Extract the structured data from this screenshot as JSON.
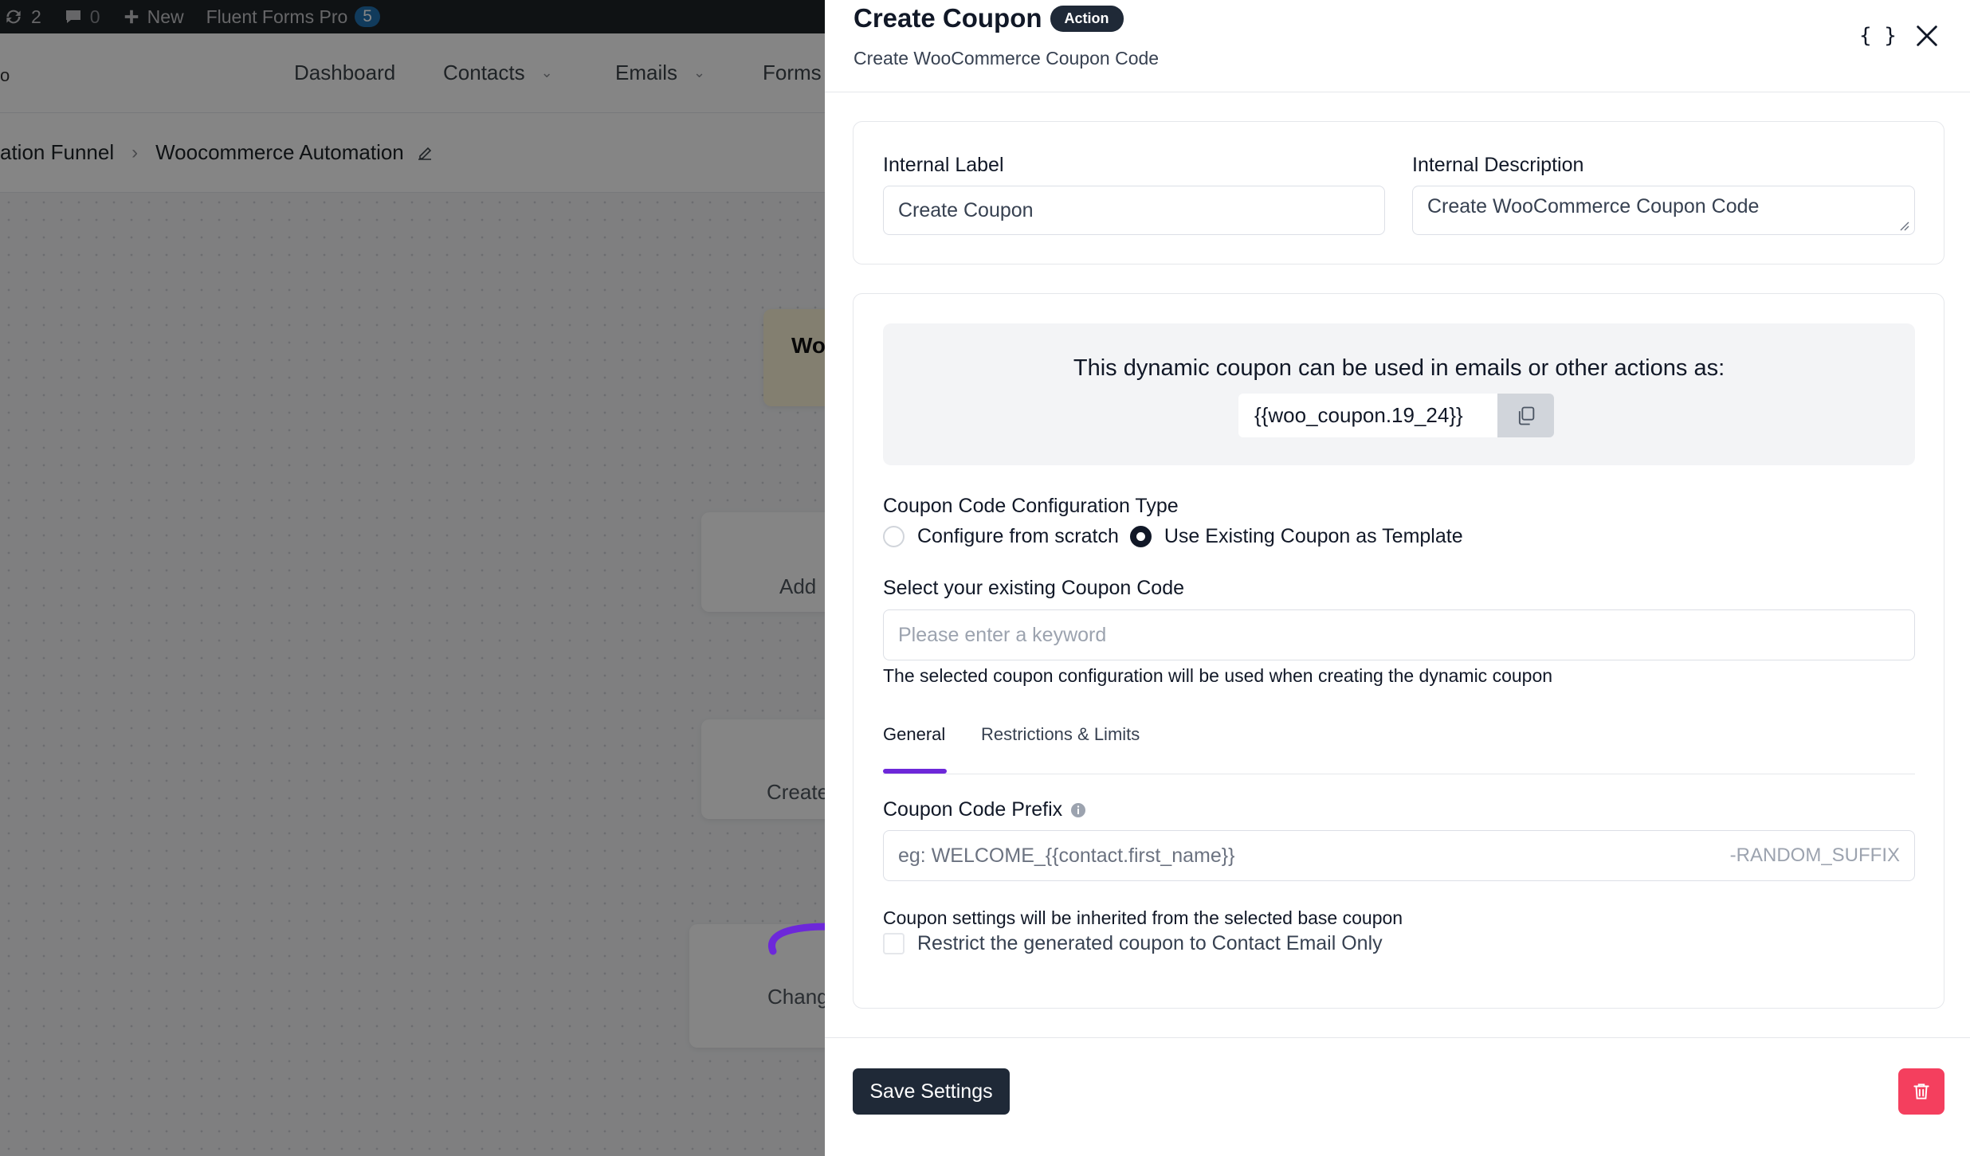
{
  "adminbar": {
    "updates_count": "2",
    "comments_count": "0",
    "new_label": "New",
    "plugin_label": "Fluent Forms Pro",
    "plugin_badge": "5"
  },
  "topnav": {
    "logo_fragment": "o",
    "items": [
      "Dashboard",
      "Contacts",
      "Emails",
      "Forms"
    ]
  },
  "breadcrumb": {
    "parent": "ation Funnel",
    "current": "Woocommerce Automation"
  },
  "canvas": {
    "trigger_node": "Wo",
    "node_add": "Add",
    "node_create": "Create",
    "node_change": "Chang"
  },
  "drawer": {
    "title": "Create Coupon",
    "badge": "Action",
    "subtitle": "Create WooCommerce Coupon Code",
    "braces_label": "{ }"
  },
  "form": {
    "internal_label": {
      "label": "Internal Label",
      "value": "Create Coupon"
    },
    "internal_description": {
      "label": "Internal Description",
      "value": "Create WooCommerce Coupon Code"
    }
  },
  "coupon": {
    "info_text": "This dynamic coupon can be used in emails or other actions as:",
    "smartcode": "{{woo_coupon.19_24}}",
    "config_type_label": "Coupon Code Configuration Type",
    "config_options": [
      {
        "label": "Configure from scratch",
        "selected": false
      },
      {
        "label": "Use Existing Coupon as Template",
        "selected": true
      }
    ],
    "select_label": "Select your existing Coupon Code",
    "select_placeholder": "Please enter a keyword",
    "select_help": "The selected coupon configuration will be used when creating the dynamic coupon",
    "tabs": [
      {
        "label": "General",
        "active": true
      },
      {
        "label": "Restrictions & Limits",
        "active": false
      }
    ],
    "prefix_label": "Coupon Code Prefix",
    "prefix_placeholder": "eg: WELCOME_{{contact.first_name}}",
    "prefix_suffix": "-RANDOM_SUFFIX",
    "inherit_note": "Coupon settings will be inherited from the selected base coupon",
    "restrict_label": "Restrict the generated coupon to Contact Email Only",
    "restrict_checked": false
  },
  "footer": {
    "save_label": "Save Settings"
  },
  "colors": {
    "accent": "#6d28d9",
    "primary_button": "#1f2937",
    "danger": "#f43f5e"
  }
}
